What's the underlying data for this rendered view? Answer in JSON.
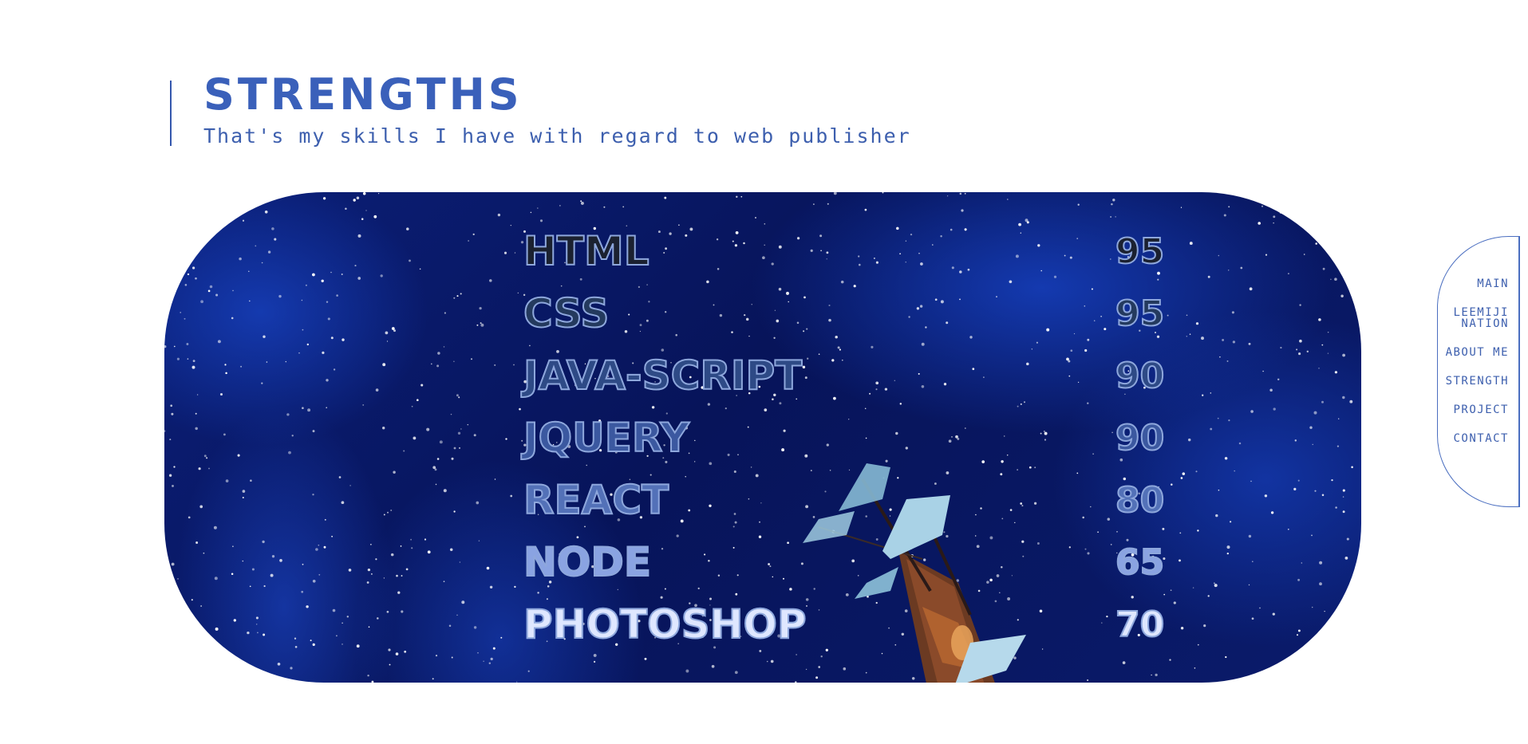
{
  "header": {
    "title": "STRENGTHS",
    "subtitle": "That's my skills I have with regard to web publisher"
  },
  "skills": [
    {
      "name": "HTML",
      "value": "95",
      "color": "#1b2130"
    },
    {
      "name": "CSS",
      "value": "95",
      "color": "#243a5e"
    },
    {
      "name": "JAVA-SCRIPT",
      "value": "90",
      "color": "#2e4a86"
    },
    {
      "name": "JQUERY",
      "value": "90",
      "color": "#3b58a0"
    },
    {
      "name": "REACT",
      "value": "80",
      "color": "#5371b8"
    },
    {
      "name": "NODE",
      "value": "65",
      "color": "#8aa3e2"
    },
    {
      "name": "PHOTOSHOP",
      "value": "70",
      "color": "#dfe7ff"
    }
  ],
  "nav": {
    "items": [
      "MAIN",
      "LEEMIJI NATION",
      "ABOUT ME",
      "STRENGTH",
      "PROJECT",
      "CONTACT"
    ],
    "item_lines": [
      [
        "MAIN"
      ],
      [
        "LEEMIJI",
        "NATION"
      ],
      [
        "ABOUT ME"
      ],
      [
        "STRENGTH"
      ],
      [
        "PROJECT"
      ],
      [
        "CONTACT"
      ]
    ]
  },
  "colors": {
    "accent": "#3a60ba",
    "hero_bg": "#07145a"
  }
}
